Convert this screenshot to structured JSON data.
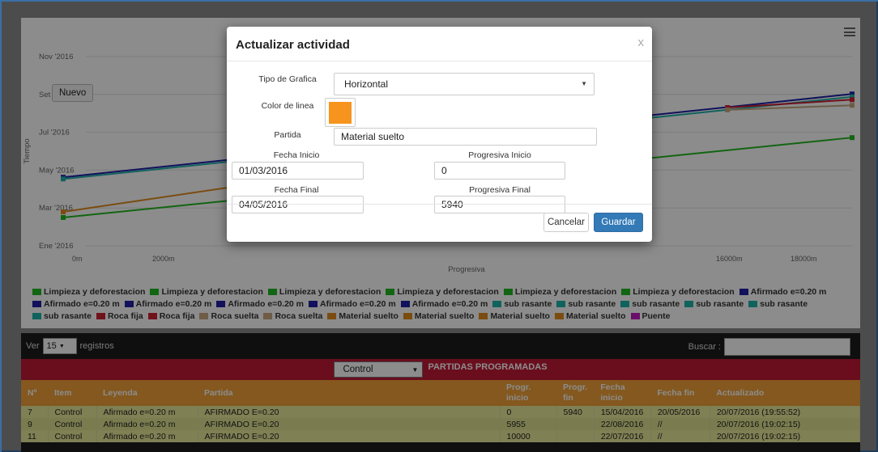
{
  "chart": {
    "nuevo_label": "Nuevo",
    "yaxis_title": "Tiempo",
    "xaxis_title": "Progresiva",
    "yticks": [
      "Nov '2016",
      "Set '2016",
      "Jul '2016",
      "May '2016",
      "Mar '2016",
      "Ene '2016"
    ],
    "xticks": [
      "0m",
      "2000m",
      "16000m",
      "18000m"
    ]
  },
  "chart_data": {
    "type": "line",
    "title": "",
    "xlabel": "Progresiva",
    "ylabel": "Tiempo",
    "x_unit": "m",
    "xlim": [
      0,
      19000
    ],
    "ylim": [
      "2016-01-01",
      "2016-11-30"
    ],
    "series": [
      {
        "name": "Afirmado e=0.20 m",
        "color": "#1f1fa8",
        "points": [
          [
            0,
            "2016-05-01"
          ],
          [
            19000,
            "2016-09-25"
          ]
        ]
      },
      {
        "name": "sub rasante",
        "color": "#20b2aa",
        "points": [
          [
            0,
            "2016-04-28"
          ],
          [
            19000,
            "2016-09-20"
          ]
        ]
      },
      {
        "name": "Roca fija",
        "color": "#cc2233",
        "points": [
          [
            16000,
            "2016-09-01"
          ],
          [
            19000,
            "2016-09-15"
          ]
        ]
      },
      {
        "name": "Roca suelta",
        "color": "#c8a882",
        "points": [
          [
            16000,
            "2016-08-28"
          ],
          [
            19000,
            "2016-09-05"
          ]
        ]
      },
      {
        "name": "Material suelto",
        "color": "#e08a1e",
        "points": [
          [
            0,
            "2016-03-01"
          ],
          [
            5940,
            "2016-05-04"
          ]
        ]
      },
      {
        "name": "Limpieza y deforestacion",
        "color": "#22b822",
        "points": [
          [
            0,
            "2016-02-20"
          ],
          [
            19000,
            "2016-07-10"
          ]
        ]
      }
    ]
  },
  "legend": {
    "items": [
      {
        "label": "Limpieza y deforestacion",
        "color": "#22b822"
      },
      {
        "label": "Limpieza y deforestacion",
        "color": "#22b822"
      },
      {
        "label": "Limpieza y deforestacion",
        "color": "#22b822"
      },
      {
        "label": "Limpieza y deforestacion",
        "color": "#22b822"
      },
      {
        "label": "Limpieza y deforestacion",
        "color": "#22b822"
      },
      {
        "label": "Limpieza y deforestacion",
        "color": "#22b822"
      },
      {
        "label": "Afirmado e=0.20 m",
        "color": "#1f1fa8"
      },
      {
        "label": "Afirmado e=0.20 m",
        "color": "#1f1fa8"
      },
      {
        "label": "Afirmado e=0.20 m",
        "color": "#1f1fa8"
      },
      {
        "label": "Afirmado e=0.20 m",
        "color": "#1f1fa8"
      },
      {
        "label": "Afirmado e=0.20 m",
        "color": "#1f1fa8"
      },
      {
        "label": "Afirmado e=0.20 m",
        "color": "#1f1fa8"
      },
      {
        "label": "sub rasante",
        "color": "#20b2aa"
      },
      {
        "label": "sub rasante",
        "color": "#20b2aa"
      },
      {
        "label": "sub rasante",
        "color": "#20b2aa"
      },
      {
        "label": "sub rasante",
        "color": "#20b2aa"
      },
      {
        "label": "sub rasante",
        "color": "#20b2aa"
      },
      {
        "label": "sub rasante",
        "color": "#20b2aa"
      },
      {
        "label": "Roca fija",
        "color": "#cc2233"
      },
      {
        "label": "Roca fija",
        "color": "#cc2233"
      },
      {
        "label": "Roca suelta",
        "color": "#c8a882"
      },
      {
        "label": "Roca suelta",
        "color": "#c8a882"
      },
      {
        "label": "Material suelto",
        "color": "#e08a1e"
      },
      {
        "label": "Material suelto",
        "color": "#e08a1e"
      },
      {
        "label": "Material suelto",
        "color": "#e08a1e"
      },
      {
        "label": "Material suelto",
        "color": "#e08a1e"
      },
      {
        "label": "Puente",
        "color": "#c21ac2"
      }
    ]
  },
  "table": {
    "ver_label": "Ver",
    "page_size": "15",
    "registros_label": "registros",
    "buscar_label": "Buscar :",
    "control_select": "Control",
    "title": "PARTIDAS PROGRAMADAS",
    "headers": [
      "Nº",
      "Item",
      "Leyenda",
      "Partida",
      "Progr. inicio",
      "Progr. fin",
      "Fecha inicio",
      "Fecha fin",
      "Actualizado"
    ],
    "rows": [
      [
        "7",
        "Control",
        "Afirmado e=0.20 m",
        "AFIRMADO E=0.20",
        "0",
        "5940",
        "15/04/2016",
        "20/05/2016",
        "20/07/2016 (19:55:52)"
      ],
      [
        "9",
        "Control",
        "Afirmado e=0.20 m",
        "AFIRMADO E=0.20",
        "5955",
        "",
        "22/08/2016",
        "//",
        "20/07/2016 (19:02:15)"
      ],
      [
        "11",
        "Control",
        "Afirmado e=0.20 m",
        "AFIRMADO E=0.20",
        "10000",
        "",
        "22/07/2016",
        "//",
        "20/07/2016 (19:02:15)"
      ]
    ]
  },
  "modal": {
    "title": "Actualizar actividad",
    "close": "x",
    "tipo_label": "Tipo de Grafica",
    "tipo_value": "Horizontal",
    "color_label": "Color de linea",
    "color_value": "#f7941d",
    "partida_label": "Partida",
    "partida_value": "Material suelto",
    "fecha_inicio_label": "Fecha Inicio",
    "fecha_inicio_value": "01/03/2016",
    "progresiva_inicio_label": "Progresiva Inicio",
    "progresiva_inicio_value": "0",
    "fecha_final_label": "Fecha Final",
    "fecha_final_value": "04/05/2016",
    "progresiva_final_label": "Progresiva Final",
    "progresiva_final_value": "5940",
    "cancel_label": "Cancelar",
    "save_label": "Guardar"
  }
}
